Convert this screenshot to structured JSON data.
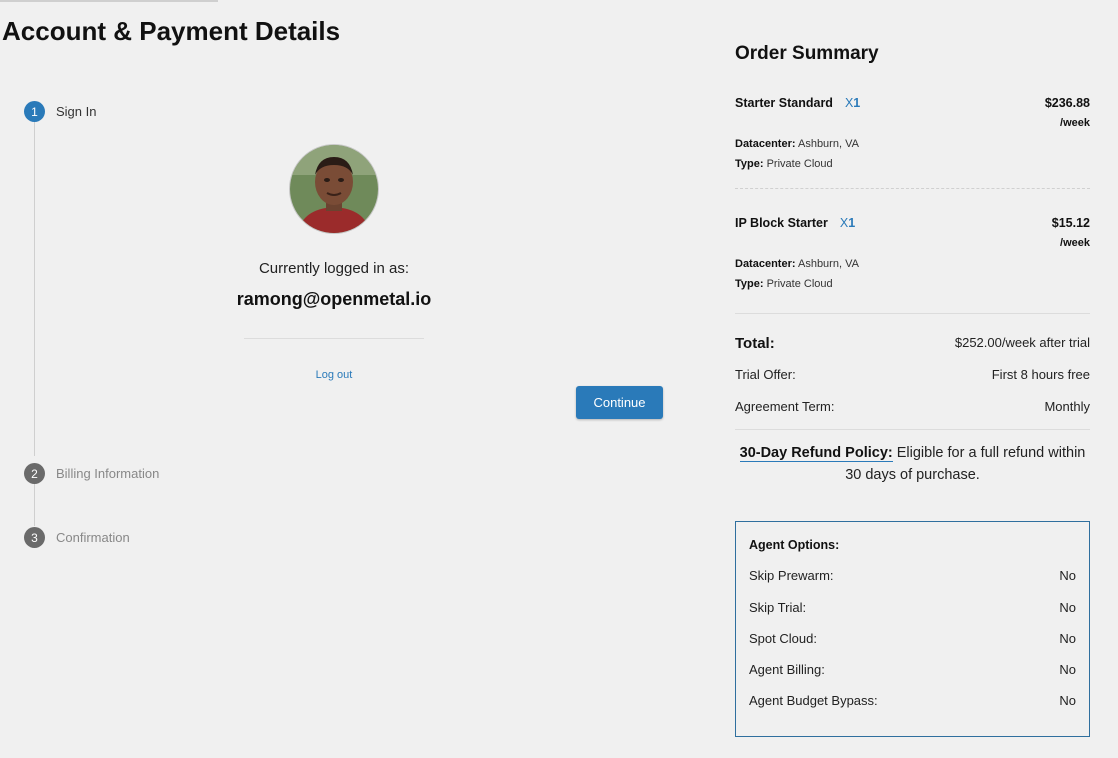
{
  "page": {
    "title": "Account & Payment Details"
  },
  "steps": [
    {
      "number": "1",
      "label": "Sign In"
    },
    {
      "number": "2",
      "label": "Billing Information"
    },
    {
      "number": "3",
      "label": "Confirmation"
    }
  ],
  "sign_in": {
    "logged_in_label": "Currently logged in as:",
    "email": "ramong@openmetal.io",
    "logout_label": "Log out",
    "continue_label": "Continue"
  },
  "summary": {
    "title": "Order Summary",
    "items": [
      {
        "name": "Starter Standard",
        "qty_prefix": "X",
        "qty": "1",
        "price": "$236.88",
        "period": "/week",
        "datacenter_label": "Datacenter:",
        "datacenter": "Ashburn, VA",
        "type_label": "Type:",
        "type": "Private Cloud"
      },
      {
        "name": "IP Block Starter",
        "qty_prefix": "X",
        "qty": "1",
        "price": "$15.12",
        "period": "/week",
        "datacenter_label": "Datacenter:",
        "datacenter": "Ashburn, VA",
        "type_label": "Type:",
        "type": "Private Cloud"
      }
    ],
    "total_label": "Total:",
    "total_value": "$252.00/week after trial",
    "trial_label": "Trial Offer:",
    "trial_value": "First 8 hours free",
    "term_label": "Agreement Term:",
    "term_value": "Monthly",
    "refund_link": "30-Day Refund Policy:",
    "refund_text": "Eligible for a full refund within 30 days of purchase."
  },
  "agent_options": {
    "title": "Agent Options:",
    "rows": [
      {
        "label": "Skip Prewarm:",
        "value": "No"
      },
      {
        "label": "Skip Trial:",
        "value": "No"
      },
      {
        "label": "Spot Cloud:",
        "value": "No"
      },
      {
        "label": "Agent Billing:",
        "value": "No"
      },
      {
        "label": "Agent Budget Bypass:",
        "value": "No"
      }
    ]
  },
  "colors": {
    "accent": "#2a7ab9",
    "box_border": "#2f6f9e",
    "background": "#f0f0f0"
  }
}
